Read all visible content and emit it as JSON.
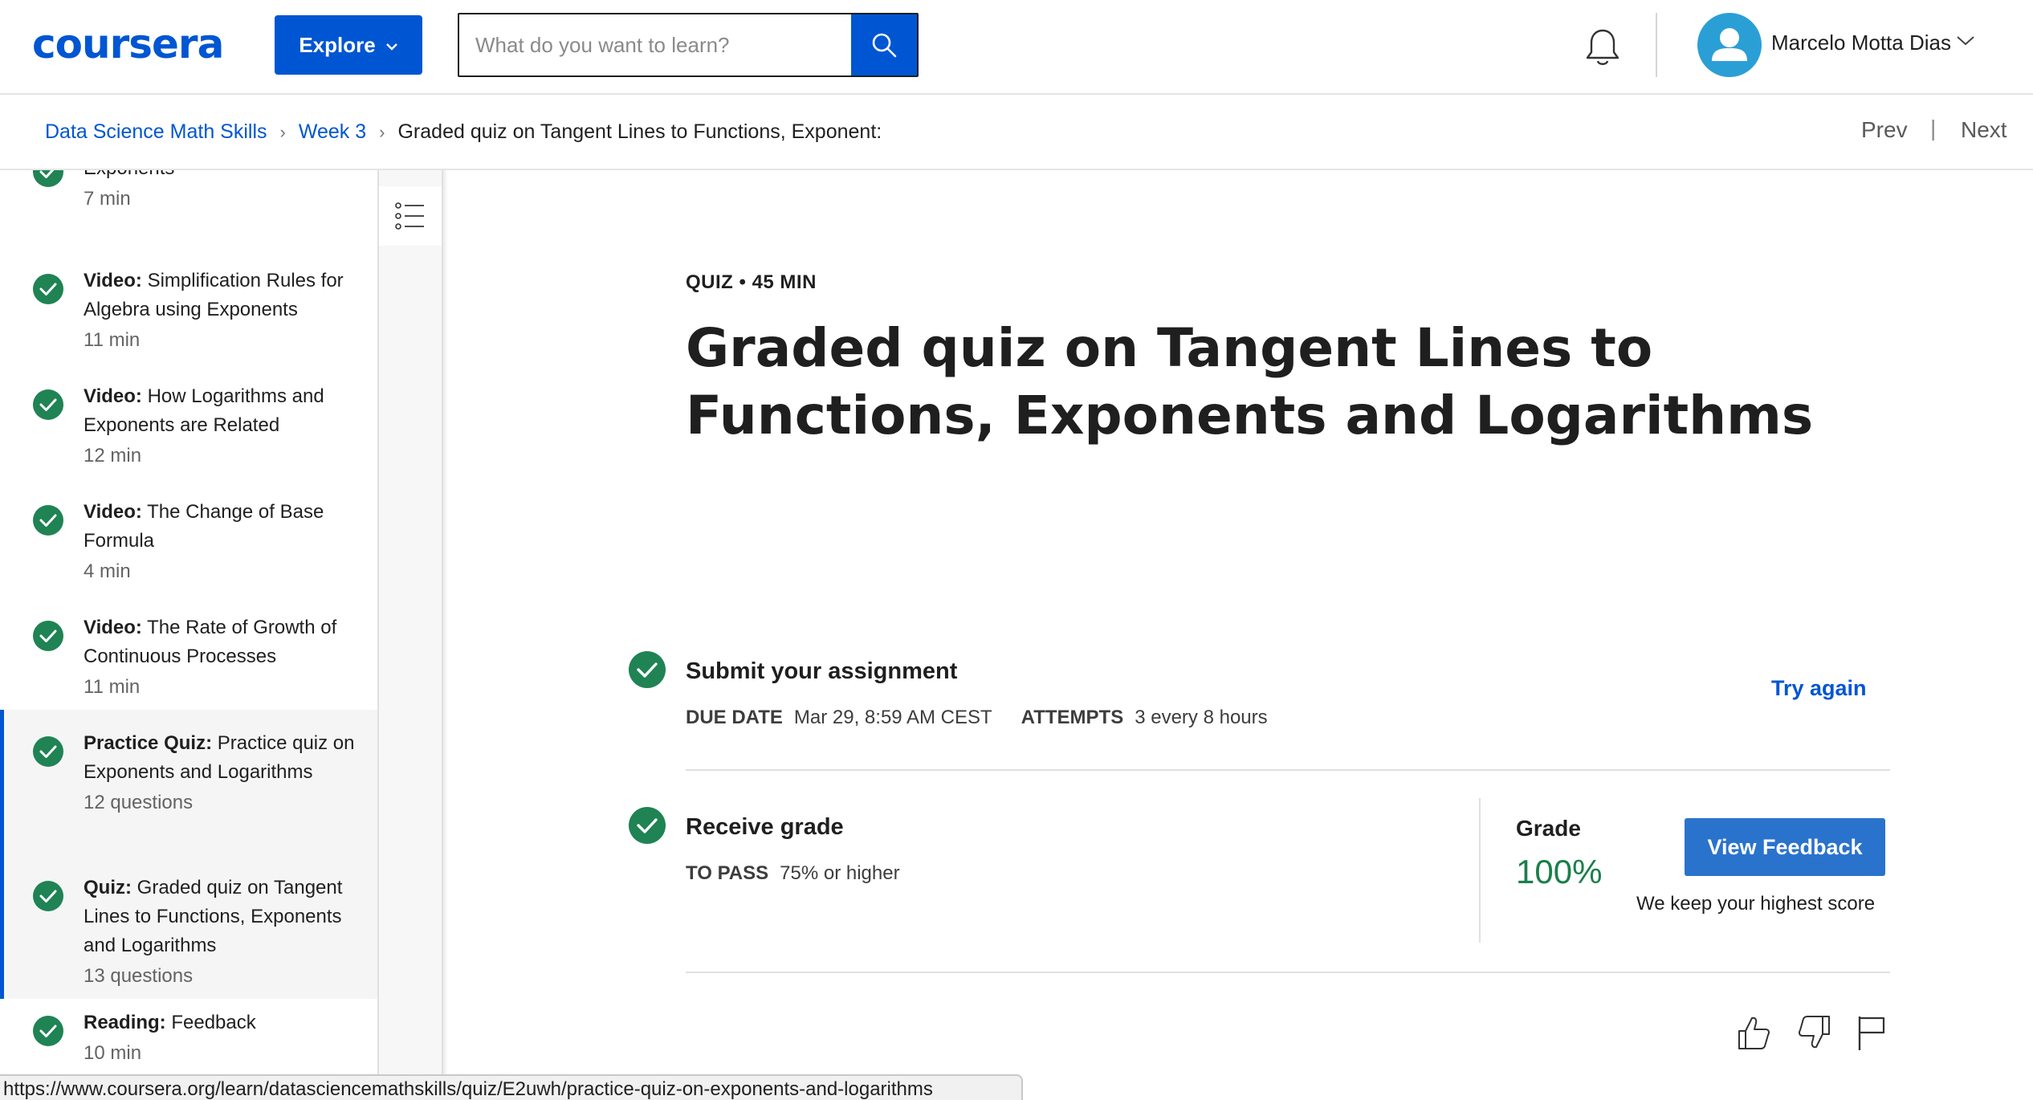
{
  "header": {
    "logo": "coursera",
    "explore_label": "Explore",
    "search_placeholder": "What do you want to learn?",
    "user_name": "Marcelo Motta Dias",
    "brand_color": "#0056d2"
  },
  "breadcrumb": {
    "items": [
      "Data Science Math Skills",
      "Week 3"
    ],
    "current": "Graded quiz on Tangent Lines to Functions, Exponent:",
    "prev": "Prev",
    "separator": "|",
    "next": "Next"
  },
  "sidebar": {
    "items": [
      {
        "type": "",
        "label": "Exponents",
        "meta": "7 min",
        "completed": true
      },
      {
        "type": "Video:",
        "label": "Simplification Rules for Algebra using Exponents",
        "meta": "11 min",
        "completed": true
      },
      {
        "type": "Video:",
        "label": "How Logarithms and Exponents are Related",
        "meta": "12 min",
        "completed": true
      },
      {
        "type": "Video:",
        "label": "The Change of Base Formula",
        "meta": "4 min",
        "completed": true
      },
      {
        "type": "Video:",
        "label": "The Rate of Growth of Continuous Processes",
        "meta": "11 min",
        "completed": true
      },
      {
        "type": "Practice Quiz:",
        "label": "Practice quiz on Exponents and Logarithms",
        "meta": "12 questions",
        "completed": true
      },
      {
        "type": "Quiz:",
        "label": "Graded quiz on Tangent Lines to Functions, Exponents and Logarithms",
        "meta": "13 questions",
        "completed": true
      },
      {
        "type": "Reading:",
        "label": "Feedback",
        "meta": "10 min",
        "completed": true
      }
    ]
  },
  "main": {
    "kicker": "QUIZ • 45 MIN",
    "title": "Graded quiz on Tangent Lines to Functions, Exponents and Logarithms",
    "submit": {
      "title": "Submit your assignment",
      "due_label": "DUE DATE",
      "due_value": "Mar 29, 8:59 AM CEST",
      "attempts_label": "ATTEMPTS",
      "attempts_value": "3 every 8 hours",
      "try_again": "Try again"
    },
    "grade": {
      "title": "Receive grade",
      "pass_label": "TO PASS",
      "pass_value": "75% or higher",
      "grade_label": "Grade",
      "grade_value": "100%",
      "feedback_button": "View Feedback",
      "note": "We keep your highest score"
    },
    "success_color": "#1a7f4b"
  },
  "status_url": "https://www.coursera.org/learn/datasciencemathskills/quiz/E2uwh/practice-quiz-on-exponents-and-logarithms"
}
